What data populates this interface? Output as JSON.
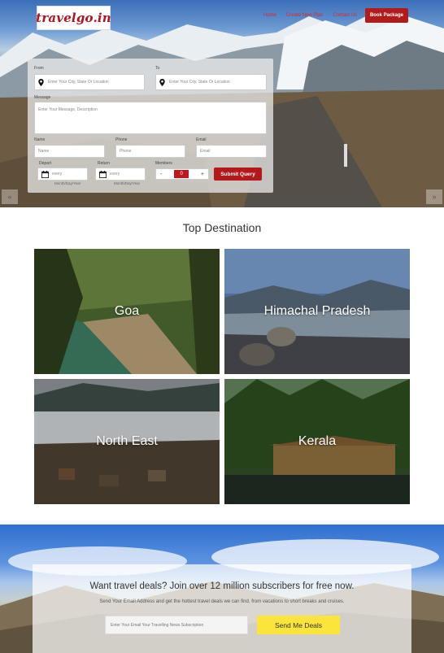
{
  "brand": {
    "logo_text": "travelgo.in"
  },
  "nav": {
    "items": [
      "Home",
      "Create New Plan",
      "Contact Us"
    ],
    "book_label": "Book Package"
  },
  "slider": {
    "prev": "«",
    "next": "»"
  },
  "form": {
    "from_label": "From",
    "from_placeholder": "Enter Your City, State Or Location",
    "to_label": "To",
    "to_placeholder": "Enter Your City, State Or Location",
    "message_label": "Message",
    "message_placeholder": "Enter Your Message, Description",
    "name_label": "Name",
    "name_placeholder": "Name",
    "phone_label": "Phone",
    "phone_placeholder": "Phone",
    "email_label": "Email",
    "email_placeholder": "Email",
    "depart_label": "Depart",
    "depart_value": "every",
    "depart_hint": "Month/Day/Year",
    "return_label": "Return",
    "return_value": "every",
    "return_hint": "Month/Day/Year",
    "members_label": "Members",
    "minus": "-",
    "members_value": "0",
    "plus": "+",
    "submit_label": "Submit Query"
  },
  "destinations": {
    "title": "Top Destination",
    "items": [
      "Goa",
      "Himachal Pradesh",
      "North East",
      "Kerala"
    ]
  },
  "subscribe": {
    "title": "Want travel deals? Join over 12 million subscribers for free now.",
    "text": "Send Your Email Address and get the hottest travel deals we can find, from vacations to short breaks and cruises.",
    "email_placeholder": "Enter Your Email Your Travelling News Subscription",
    "button_label": "Send Me Deals"
  },
  "colors": {
    "brand_red": "#b3181b",
    "deal_yellow": "#fbe43c"
  }
}
